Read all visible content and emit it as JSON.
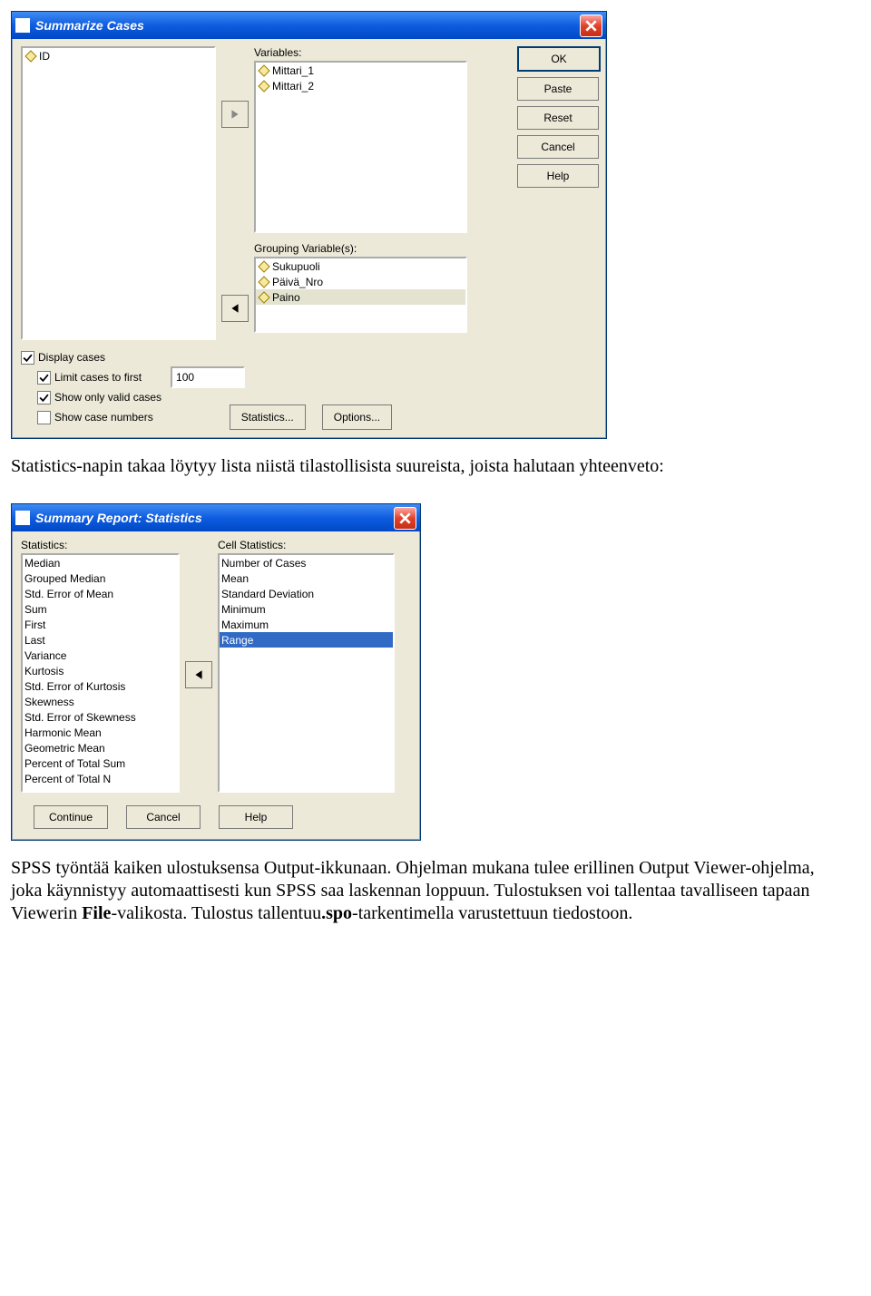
{
  "dialog1": {
    "title": "Summarize Cases",
    "left_vars": [
      "ID"
    ],
    "vars_label": "Variables:",
    "vars": [
      "Mittari_1",
      "Mittari_2"
    ],
    "group_label": "Grouping Variable(s):",
    "group_vars": [
      "Sukupuoli",
      "Päivä_Nro",
      "Paino"
    ],
    "buttons": {
      "ok": "OK",
      "paste": "Paste",
      "reset": "Reset",
      "cancel": "Cancel",
      "help": "Help"
    },
    "chk": {
      "display": "Display cases",
      "limit": "Limit cases to first",
      "valid": "Show only valid cases",
      "numbers": "Show case numbers"
    },
    "limit_value": "100",
    "stats_btn": "Statistics...",
    "opts_btn": "Options..."
  },
  "para1": "Statistics-napin takaa löytyy lista niistä tilastollisista suureista, joista halutaan yhteenveto:",
  "dialog2": {
    "title": "Summary Report: Statistics",
    "stats_label": "Statistics:",
    "cell_label": "Cell Statistics:",
    "left": [
      "Median",
      "Grouped Median",
      "Std. Error of Mean",
      "Sum",
      "First",
      "Last",
      "Variance",
      "Kurtosis",
      "Std. Error of Kurtosis",
      "Skewness",
      "Std. Error of Skewness",
      "Harmonic Mean",
      "Geometric Mean",
      "Percent of Total Sum",
      "Percent of Total N"
    ],
    "right": [
      "Number of Cases",
      "Mean",
      "Standard Deviation",
      "Minimum",
      "Maximum",
      "Range"
    ],
    "selected": "Range",
    "buttons": {
      "continue": "Continue",
      "cancel": "Cancel",
      "help": "Help"
    }
  },
  "para2a": "SPSS työntää kaiken ulostuksensa Output-ikkunaan. Ohjelman mukana tulee erillinen Output Viewer-ohjelma, joka käynnistyy automaattisesti kun SPSS saa laskennan loppuun. Tulostuksen voi tallentaa tavalliseen tapaan Viewerin ",
  "para2b": "File",
  "para2c": "-valikosta. Tulostus tallentuu",
  "para2d": ".spo",
  "para2e": "-tarkentimella varustettuun tiedostoon."
}
